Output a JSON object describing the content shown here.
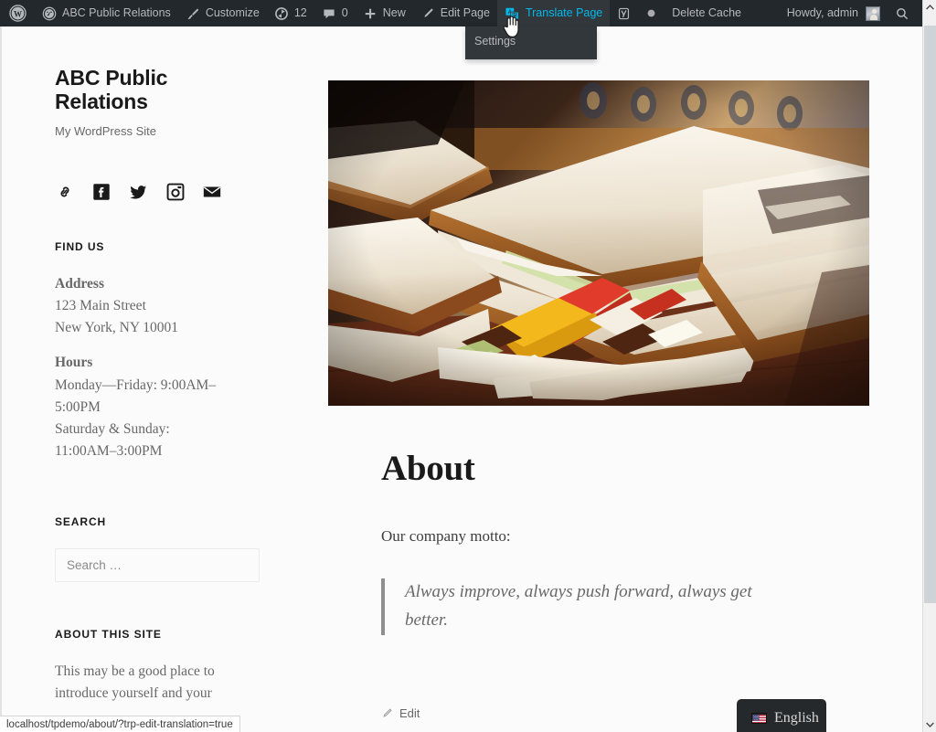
{
  "adminbar": {
    "wp_logo": "wordpress-logo-icon",
    "items": [
      {
        "id": "site-name",
        "icon": "dashboard-icon",
        "label": "ABC Public Relations"
      },
      {
        "id": "customize",
        "icon": "paintbrush-icon",
        "label": "Customize"
      },
      {
        "id": "updates",
        "icon": "updates-icon",
        "label": "12"
      },
      {
        "id": "comments",
        "icon": "comment-icon",
        "label": "0"
      },
      {
        "id": "new-content",
        "icon": "plus-icon",
        "label": "New"
      },
      {
        "id": "edit-page",
        "icon": "pencil-icon",
        "label": "Edit Page"
      },
      {
        "id": "translate-page",
        "icon": "translate-icon",
        "label": "Translate Page"
      },
      {
        "id": "yoast-seo",
        "icon": "yoast-icon",
        "label": ""
      },
      {
        "id": "delete-cache",
        "icon": "circle-icon",
        "label": "Delete Cache"
      }
    ],
    "translate_dropdown": {
      "items": [
        {
          "label": "Settings"
        }
      ]
    },
    "account": {
      "greeting": "Howdy, admin",
      "avatar": "user-avatar"
    },
    "search": {
      "icon": "search-icon"
    },
    "hover_color": "#00b9eb",
    "bg_color": "#23282d"
  },
  "sidebar": {
    "site_title": "ABC Public Relations",
    "site_description": "My WordPress Site",
    "social": [
      {
        "name": "link-icon",
        "title": "Link"
      },
      {
        "name": "facebook-icon",
        "title": "Facebook"
      },
      {
        "name": "twitter-icon",
        "title": "Twitter"
      },
      {
        "name": "instagram-icon",
        "title": "Instagram"
      },
      {
        "name": "email-icon",
        "title": "Email"
      }
    ],
    "find_us": {
      "title": "FIND US",
      "address_label": "Address",
      "address_line1": "123 Main Street",
      "address_line2": "New York, NY 10001",
      "hours_label": "Hours",
      "hours_line1": "Monday—Friday: 9:00AM–5:00PM",
      "hours_line2": "Saturday & Sunday: 11:00AM–3:00PM"
    },
    "search": {
      "title": "SEARCH",
      "placeholder": "Search …",
      "value": ""
    },
    "about_site": {
      "title": "ABOUT THIS SITE",
      "text": "This may be a good place to introduce yourself and your"
    }
  },
  "main": {
    "featured_image_alt": "club sandwich on wooden board",
    "title": "About",
    "paragraph": "Our company motto:",
    "quote": "Always improve, always push forward, always get better.",
    "edit_label": "Edit",
    "edit_icon": "pencil-icon"
  },
  "language_switcher": {
    "current": "English",
    "flag": "flag-us-icon"
  },
  "scrollbar": {
    "up_icon": "chevron-up-icon",
    "down_icon": "chevron-down-icon"
  },
  "statusbar": {
    "url": "localhost/tpdemo/about/?trp-edit-translation=true"
  }
}
